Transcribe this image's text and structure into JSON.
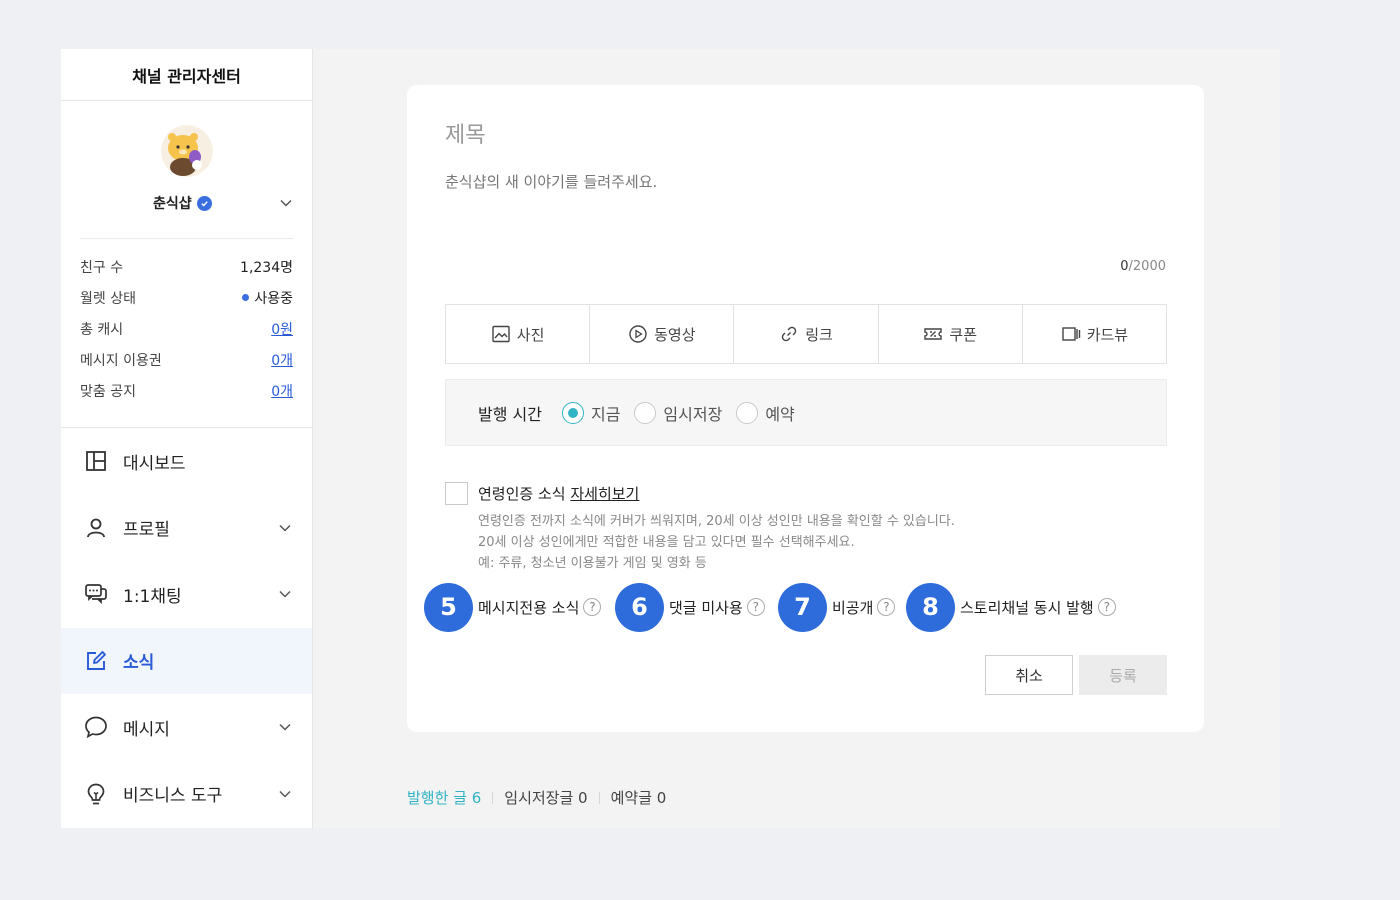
{
  "sidebar": {
    "title": "채널 관리자센터",
    "channel_name": "춘식샵",
    "stats": [
      {
        "label": "친구 수",
        "value": "1,234명"
      },
      {
        "label": "월렛 상태",
        "value": "사용중"
      },
      {
        "label": "총 캐시",
        "value": "0원"
      },
      {
        "label": "메시지 이용권",
        "value": "0개"
      },
      {
        "label": "맞춤 공지",
        "value": "0개"
      }
    ],
    "nav": [
      {
        "label": "대시보드",
        "icon": "dashboard-icon"
      },
      {
        "label": "프로필",
        "icon": "user-icon"
      },
      {
        "label": "1:1채팅",
        "icon": "chat-icon"
      },
      {
        "label": "소식",
        "icon": "edit-icon"
      },
      {
        "label": "메시지",
        "icon": "message-icon"
      },
      {
        "label": "비즈니스 도구",
        "icon": "lightbulb-icon"
      }
    ]
  },
  "editor": {
    "title_placeholder": "제목",
    "body_placeholder": "춘식샵의 새 이야기를 들려주세요.",
    "count_current": "0",
    "count_max": "/2000",
    "attachments": [
      "사진",
      "동영상",
      "링크",
      "쿠폰",
      "카드뷰"
    ],
    "publish_label": "발행 시간",
    "publish_options": [
      "지금",
      "임시저장",
      "예약"
    ],
    "publish_selected": "지금",
    "age_title": "연령인증 소식",
    "age_link": "자세히보기",
    "age_desc": [
      "연령인증 전까지 소식에 커버가 씌워지며, 20세 이상 성인만 내용을 확인할 수 있습니다.",
      "20세 이상 성인에게만 적합한 내용을 담고 있다면 필수 선택해주세요.",
      "예: 주류, 청소년 이용불가 게임 및 영화 등"
    ],
    "options": [
      {
        "badge": "5",
        "label": "메시지전용 소식"
      },
      {
        "badge": "6",
        "label": "댓글 미사용"
      },
      {
        "badge": "7",
        "label": "비공개"
      },
      {
        "badge": "8",
        "label": "스토리채널 동시 발행"
      }
    ],
    "help_mark": "?",
    "cancel_label": "취소",
    "submit_label": "등록"
  },
  "post_tabs": [
    "발행한 글 6",
    "임시저장글 0",
    "예약글 0"
  ],
  "colors": {
    "accent": "#31b4c4",
    "brand_blue": "#2f6cdb",
    "link": "#2a5bd7"
  }
}
